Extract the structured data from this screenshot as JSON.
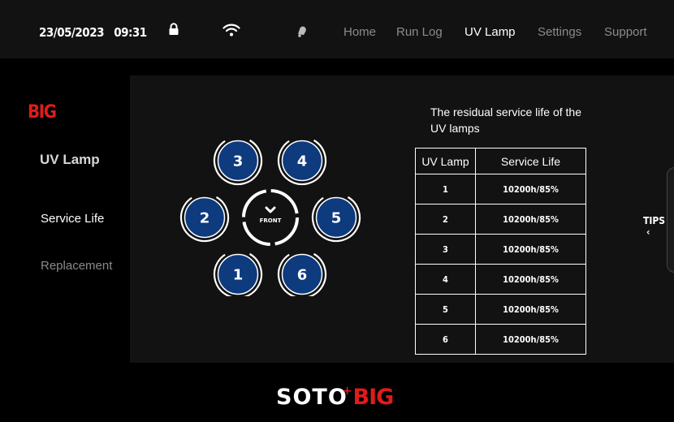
{
  "status_bar": {
    "date": "23/05/2023",
    "time": "09:31",
    "icons": [
      "lock-icon",
      "wifi-icon",
      "bell-icon"
    ]
  },
  "nav": [
    {
      "label": "Home",
      "active": false
    },
    {
      "label": "Run Log",
      "active": false
    },
    {
      "label": "UV Lamp",
      "active": true
    },
    {
      "label": "Settings",
      "active": false
    },
    {
      "label": "Support",
      "active": false
    }
  ],
  "sidebar": {
    "brand": "BIG",
    "title": "UV Lamp",
    "items": [
      {
        "label": "Service Life",
        "active": true
      },
      {
        "label": "Replacement",
        "active": false
      }
    ]
  },
  "lamp_diagram": {
    "lamps": [
      "1",
      "2",
      "3",
      "4",
      "5",
      "6"
    ],
    "center_label": "FRONT"
  },
  "service_table": {
    "description": "The residual service life of the UV lamps",
    "headers": [
      "UV Lamp",
      "Service Life"
    ],
    "rows": [
      [
        "1",
        "10200h/85%"
      ],
      [
        "2",
        "10200h/85%"
      ],
      [
        "3",
        "10200h/85%"
      ],
      [
        "4",
        "10200h/85%"
      ],
      [
        "5",
        "10200h/85%"
      ],
      [
        "6",
        "10200h/85%"
      ]
    ]
  },
  "tips": {
    "label": "TIPS"
  },
  "footer": {
    "brand_part1": "SOTO",
    "brand_plus": "+",
    "brand_part2": "BIG"
  },
  "colors": {
    "accent_red": "#e01b1b",
    "lamp_blue": "#0e3a7e",
    "panel": "#121212",
    "background": "#000000"
  }
}
